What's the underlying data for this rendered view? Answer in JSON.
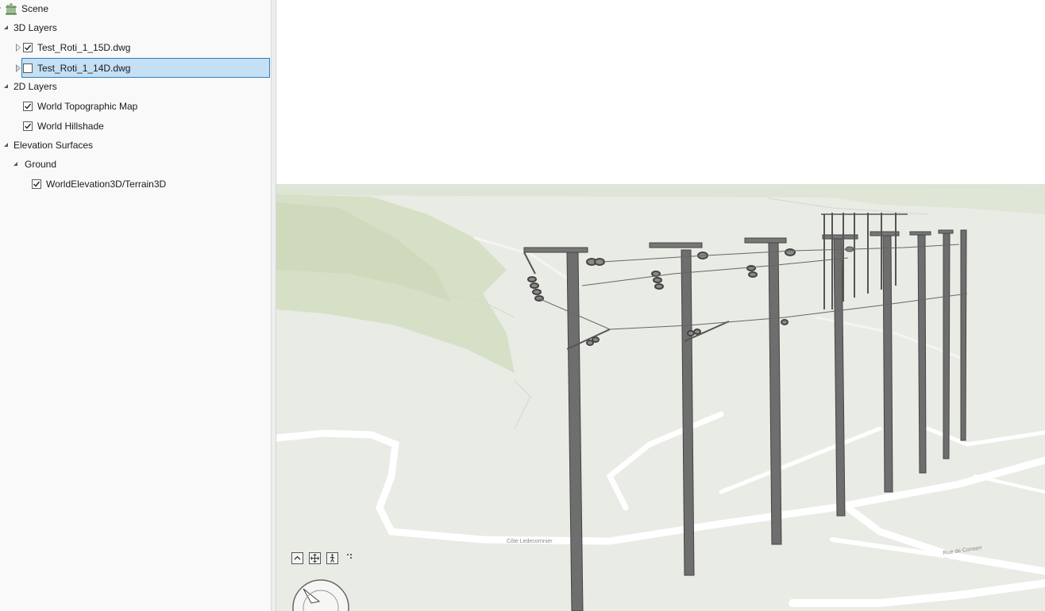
{
  "contents": {
    "scene_label": "Scene",
    "layers_3d": {
      "label": "3D Layers",
      "items": [
        {
          "label": "Test_Roti_1_15D.dwg",
          "checked": true,
          "selected": false
        },
        {
          "label": "Test_Roti_1_14D.dwg",
          "checked": false,
          "selected": true
        }
      ]
    },
    "layers_2d": {
      "label": "2D Layers",
      "items": [
        {
          "label": "World Topographic Map",
          "checked": true
        },
        {
          "label": "World Hillshade",
          "checked": true
        }
      ]
    },
    "elevation": {
      "label": "Elevation Surfaces",
      "ground": {
        "label": "Ground",
        "items": [
          {
            "label": "WorldElevation3D/Terrain3D",
            "checked": true
          }
        ]
      }
    }
  },
  "scene": {
    "colors": {
      "sky": "#ffffff",
      "terrain": "#e9ebe5",
      "vegetation": "#d9e2cb",
      "roads": "#ffffff",
      "poles": "#6b6b6b",
      "selection": "#c5dff3",
      "selection_border": "#2a7fc4"
    },
    "road_labels": [
      "Rue de Conserr",
      "Côte Ledecornnier"
    ]
  },
  "nav_controls": {
    "icons": [
      "chevron-up-icon",
      "full-extent-icon",
      "walk-mode-icon",
      "pan-icon",
      "navigator-icon"
    ]
  }
}
